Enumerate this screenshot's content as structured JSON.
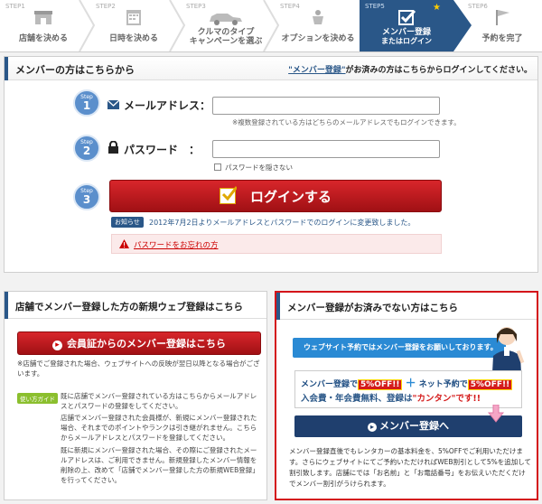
{
  "steps": [
    {
      "num": "STEP1",
      "label": "店舗を決める",
      "icon": "store-icon"
    },
    {
      "num": "STEP2",
      "label": "日時を決める",
      "icon": "calendar-icon"
    },
    {
      "num": "STEP3",
      "label_line1": "クルマのタイプ",
      "label_line2": "キャンペーンを選ぶ",
      "icon": "car-icon"
    },
    {
      "num": "STEP4",
      "label": "オプションを決める",
      "icon": "child-seat-icon"
    },
    {
      "num": "STEP5",
      "label_line1": "メンバー登録",
      "label_line2": "またはログイン",
      "icon": "check-icon",
      "active": true
    },
    {
      "num": "STEP6",
      "label": "予約を完了",
      "icon": "flag-icon"
    }
  ],
  "login": {
    "title": "メンバーの方はこちらから",
    "note_quote": "\"メンバー登録\"",
    "note_rest": "がお済みの方はこちらからログインしてください。",
    "step_word": "Step",
    "email_label": "メールアドレス：",
    "email_hint": "※複数登録されている方はどちらのメールアドレスでもログインできます。",
    "password_label": "パスワード　：",
    "password_hint": "パスワードを隠さない",
    "login_button": "ログインする",
    "info_badge": "お知らせ",
    "info_text": "2012年7月2日よりメールアドレスとパスワードでのログインに変更致しました。",
    "forgot_link": "パスワードをお忘れの方"
  },
  "shop": {
    "title": "店舗でメンバー登録した方の新規ウェブ登録はこちら",
    "button": "会員証からのメンバー登録はこちら",
    "note1": "※店舗でご登録された場合、ウェブサイトへの反映が翌日以降となる場合がございます。",
    "guide_badge": "使い方ガイド",
    "guide1": "既に店舗でメンバー登録されている方はこちらからメールアドレスとパスワードの登録をしてください。",
    "guide2": "店舗でメンバー登録された会員様が、新規にメンバー登録された場合、それまでのポイントやランクは引き継がれません。こちらからメールアドレスとパスワードを登録してください。",
    "guide3": "既に新規にメンバー登録された場合、その際にご登録されたメールアドレスは、ご利用できません。新規登録したメンバー情報を削除の上、改めて「店舗でメンバー登録した方の新規WEB登録」を行ってください。"
  },
  "notmember": {
    "title": "メンバー登録がお済みでない方はこちら",
    "banner": "ウェブサイト予約ではメンバー登録をお願いしております。",
    "promo_a": "メンバー登録で",
    "promo_off1": "5%OFF!!",
    "promo_plus": "＋",
    "promo_b": "ネット予約で",
    "promo_off2": "5%OFF!!",
    "promo_line2a": "入会費・年会費無料、登録は",
    "promo_line2b": "\"カンタン\"です!!",
    "button": "メンバー登録へ",
    "desc": "メンバー登録直後でもレンタカーの基本料金を、5%OFFでご利用いただけます。さらにウェブサイトにてご予約いただければWEB割引として5%を追加して割引致します。店舗にでは「お名前」と「お電話番号」をお伝えいただくだけでメンバー割引がうけられます。"
  },
  "colors": {
    "brand_blue": "#2a5788",
    "accent_red": "#d41b1b",
    "highlight_border": "#d4141a"
  }
}
